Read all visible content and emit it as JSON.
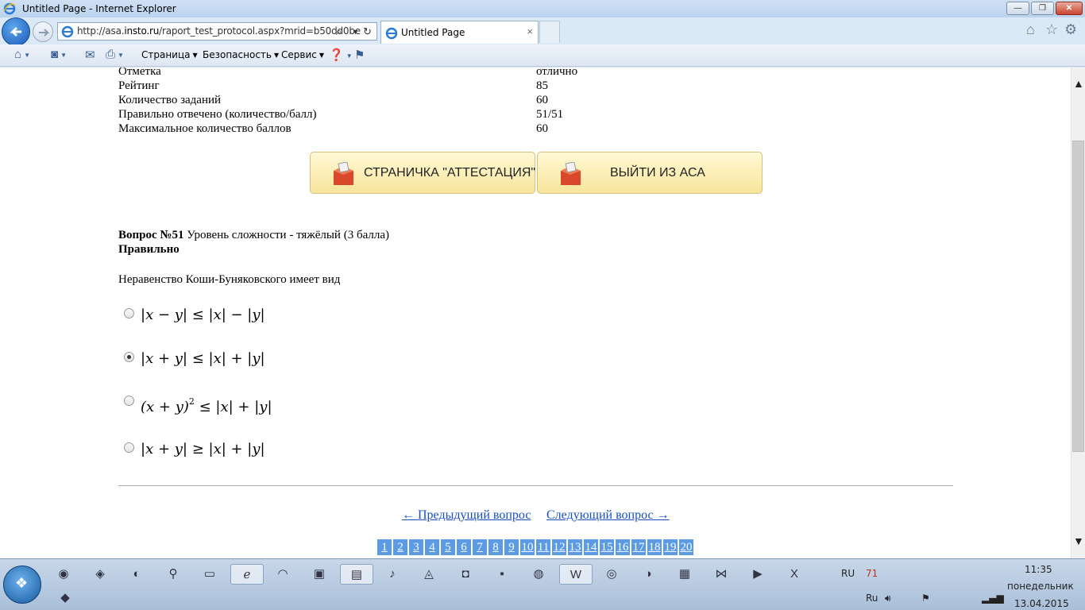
{
  "window": {
    "title": "Untitled Page - Internet Explorer",
    "minimize": "—",
    "maximize": "❐",
    "close": "✕"
  },
  "browser": {
    "url_prefix": "http://asa.",
    "url_domain": "insto.ru",
    "url_rest": "/raport_test_protocol.aspx?mrid=b50dd0be",
    "tab_title": "Untitled Page",
    "tab_close": "×"
  },
  "commandbar": {
    "page": "Страница",
    "security": "Безопасность",
    "service": "Сервис"
  },
  "summary": [
    {
      "label": "Отметка",
      "value": "отлично"
    },
    {
      "label": "Рейтинг",
      "value": "85"
    },
    {
      "label": "Количество заданий",
      "value": "60"
    },
    {
      "label": "Правильно отвечено (количество/балл)",
      "value": "51/51"
    },
    {
      "label": "Максимальное количество баллов",
      "value": "60"
    }
  ],
  "buttons": {
    "attestation": "СТРАНИЧКА \"АТТЕСТАЦИЯ\"",
    "logout": "ВЫЙТИ ИЗ АСА"
  },
  "question": {
    "number_label": "Вопрос №51",
    "difficulty": " Уровень сложности - тяжёлый (3 балла)",
    "status": "Правильно",
    "text": "Неравенство Коши-Буняковского имеет вид",
    "options": [
      {
        "formula": "|x − y| ≤ |x| − |y|",
        "selected": false
      },
      {
        "formula": "|x + y| ≤ |x| + |y|",
        "selected": true
      },
      {
        "formula_base": "(x + y)",
        "formula_exp": "2",
        "formula_tail": " ≤ |x| + |y|",
        "selected": false
      },
      {
        "formula": "|x + y| ≥ |x| + |y|",
        "selected": false
      }
    ]
  },
  "navigation": {
    "prev": "← Предыдущий вопрос",
    "next": "Следующий вопрос →",
    "pages": [
      "1",
      "2",
      "3",
      "4",
      "5",
      "6",
      "7",
      "8",
      "9",
      "10",
      "11",
      "12",
      "13",
      "14",
      "15",
      "16",
      "17",
      "18",
      "19",
      "20"
    ]
  },
  "taskbar": {
    "lang": "RU",
    "lang2": "Ru",
    "time": "11:35",
    "day": "понедельник",
    "date": "13.04.2015",
    "tray_number": "71"
  }
}
